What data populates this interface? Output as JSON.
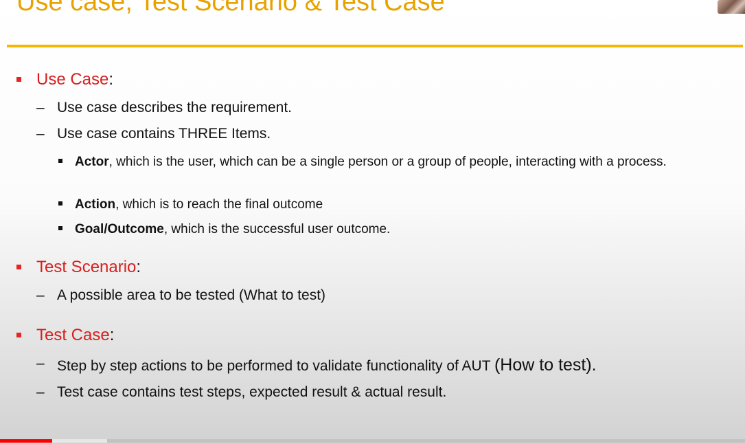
{
  "slide": {
    "title": "Use case, Test Scenario & Test Case",
    "sections": [
      {
        "heading": "Use Case",
        "colon": ":",
        "items": [
          "Use case describes the requirement.",
          "Use case contains THREE Items."
        ],
        "subitems": [
          {
            "term": "Actor",
            "rest": ", which is the user, which can be a single person or a group of people, interacting with a process."
          },
          {
            "term": "Action",
            "rest": ", which is to reach the final outcome"
          },
          {
            "term": "Goal/Outcome",
            "rest": ", which is the successful user outcome."
          }
        ]
      },
      {
        "heading": "Test Scenario",
        "colon": ":",
        "items": [
          "A possible area to be tested (What to test)"
        ]
      },
      {
        "heading": "Test Case",
        "colon": ":",
        "items": [
          "Step by step actions to be performed to validate functionality of AUT ",
          "Test case contains test steps, expected result & actual result."
        ],
        "item0_emphasis": "(How to test)."
      }
    ],
    "dash": "–"
  },
  "player": {
    "progress_played_fraction": 0.07,
    "progress_buffered_fraction": 0.144,
    "accent_color": "#ff0000"
  },
  "colors": {
    "title": "#e8a200",
    "rule": "#f5b800",
    "heading_red": "#d81e1e"
  }
}
